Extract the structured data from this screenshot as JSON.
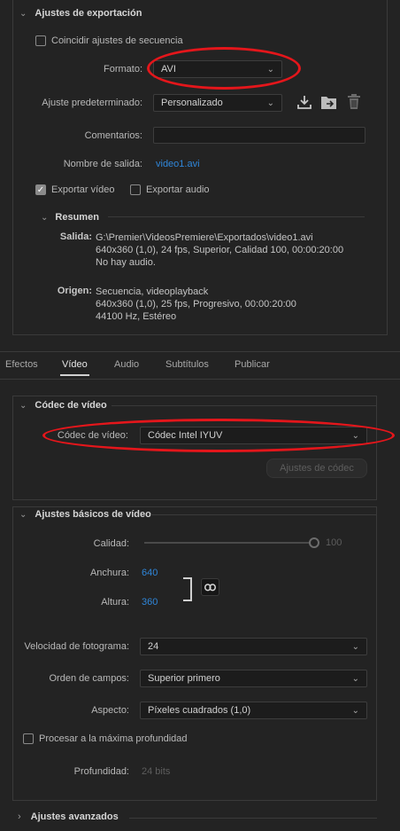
{
  "export": {
    "section_title": "Ajustes de exportación",
    "match_sequence_label": "Coincidir ajustes de secuencia",
    "format_label": "Formato:",
    "format_value": "AVI",
    "preset_label": "Ajuste predeterminado:",
    "preset_value": "Personalizado",
    "comments_label": "Comentarios:",
    "comments_value": "",
    "output_name_label": "Nombre de salida:",
    "output_name_value": "video1.avi",
    "export_video_label": "Exportar vídeo",
    "export_audio_label": "Exportar audio",
    "summary_title": "Resumen",
    "output_label": "Salida:",
    "output_lines": [
      "G:\\Premier\\VideosPremiere\\Exportados\\video1.avi",
      "640x360 (1,0), 24 fps, Superior, Calidad 100, 00:00:20:00",
      "No hay audio."
    ],
    "source_label": "Origen:",
    "source_lines": [
      "Secuencia, videoplayback",
      "640x360 (1,0), 25 fps, Progresivo, 00:00:20:00",
      "44100 Hz, Estéreo"
    ]
  },
  "tabs": [
    {
      "label": "Efectos"
    },
    {
      "label": "Vídeo"
    },
    {
      "label": "Audio"
    },
    {
      "label": "Subtítulos"
    },
    {
      "label": "Publicar"
    }
  ],
  "codec": {
    "section_title": "Códec de vídeo",
    "codec_label": "Códec de vídeo:",
    "codec_value": "Códec Intel IYUV",
    "codec_settings_button": "Ajustes de códec"
  },
  "basic": {
    "section_title": "Ajustes básicos de vídeo",
    "quality_label": "Calidad:",
    "quality_value": "100",
    "width_label": "Anchura:",
    "width_value": "640",
    "height_label": "Altura:",
    "height_value": "360",
    "framerate_label": "Velocidad de fotograma:",
    "framerate_value": "24",
    "field_order_label": "Orden de campos:",
    "field_order_value": "Superior primero",
    "aspect_label": "Aspecto:",
    "aspect_value": "Píxeles cuadrados (1,0)",
    "max_depth_label": "Procesar a la máxima profundidad",
    "depth_label": "Profundidad:",
    "depth_value": "24 bits"
  },
  "advanced": {
    "section_title": "Ajustes avanzados"
  },
  "colors": {
    "background": "#232323",
    "accent_blue": "#2f86d9",
    "annotation_red": "#e4161b"
  }
}
